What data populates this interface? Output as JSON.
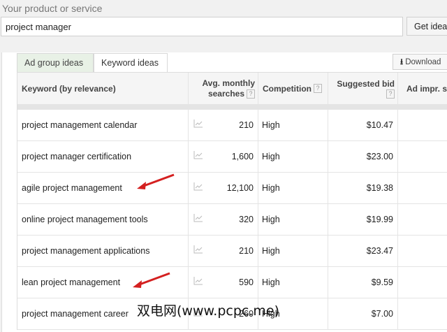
{
  "search": {
    "label": "Your product or service",
    "value": "project manager",
    "button": "Get ideas"
  },
  "tabs": [
    {
      "label": "Ad group ideas"
    },
    {
      "label": "Keyword ideas"
    }
  ],
  "download": "Download",
  "table": {
    "headers": {
      "keyword": "Keyword (by relevance)",
      "searches_1": "Avg. monthly",
      "searches_2": "searches",
      "competition": "Competition",
      "bid": "Suggested bid",
      "impr": "Ad impr. sh",
      "help": "?"
    },
    "rows": [
      {
        "keyword": "project management calendar",
        "searches": "210",
        "competition": "High",
        "bid": "$10.47"
      },
      {
        "keyword": "project manager certification",
        "searches": "1,600",
        "competition": "High",
        "bid": "$23.00"
      },
      {
        "keyword": "agile project management",
        "searches": "12,100",
        "competition": "High",
        "bid": "$19.38",
        "arrow": true
      },
      {
        "keyword": "online project management tools",
        "searches": "320",
        "competition": "High",
        "bid": "$19.99"
      },
      {
        "keyword": "project management applications",
        "searches": "210",
        "competition": "High",
        "bid": "$23.47"
      },
      {
        "keyword": "lean project management",
        "searches": "590",
        "competition": "High",
        "bid": "$9.59",
        "arrow": true
      },
      {
        "keyword": "project management career",
        "searches": "260",
        "competition": "High",
        "bid": "$7.00"
      }
    ]
  },
  "watermark": "双电网(www.pcpc.me)",
  "colors": {
    "arrow": "#d42020",
    "tab_active_bg": "#e8f1e6"
  }
}
